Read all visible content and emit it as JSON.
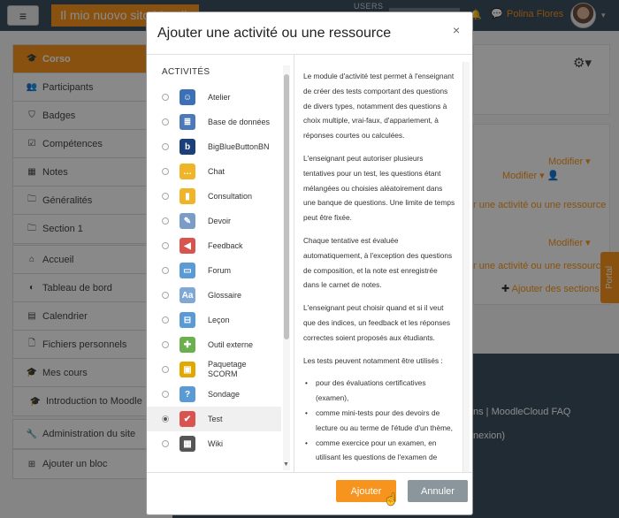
{
  "navbar": {
    "site_name": "Il mio nuovo sito Moodle",
    "users_label": "USERS",
    "user_name": "Polina Flores"
  },
  "sidebar": {
    "group1": [
      {
        "label": "Corso",
        "icon": "graduation-cap-icon",
        "glyph": "🎓",
        "active": true
      },
      {
        "label": "Participants",
        "icon": "users-icon",
        "glyph": "👥"
      },
      {
        "label": "Badges",
        "icon": "shield-icon",
        "glyph": "⛉"
      },
      {
        "label": "Compétences",
        "icon": "checkbox-icon",
        "glyph": "☑"
      },
      {
        "label": "Notes",
        "icon": "table-icon",
        "glyph": "▦"
      },
      {
        "label": "Généralités",
        "icon": "folder-icon",
        "glyph": "🗀"
      },
      {
        "label": "Section 1",
        "icon": "folder-icon",
        "glyph": "🗀"
      }
    ],
    "group2": [
      {
        "label": "Accueil",
        "icon": "home-icon",
        "glyph": "⌂"
      },
      {
        "label": "Tableau de bord",
        "icon": "dashboard-icon",
        "glyph": "◐"
      },
      {
        "label": "Calendrier",
        "icon": "calendar-icon",
        "glyph": "▤"
      },
      {
        "label": "Fichiers personnels",
        "icon": "file-icon",
        "glyph": "🗋"
      },
      {
        "label": "Mes cours",
        "icon": "graduation-cap-icon",
        "glyph": "🎓"
      },
      {
        "label": "Introduction to Moodle",
        "icon": "graduation-cap-icon",
        "glyph": "🎓",
        "indent": true
      }
    ],
    "admin": {
      "label": "Administration du site",
      "icon": "wrench-icon",
      "glyph": "🔧"
    },
    "add_block": {
      "label": "Ajouter un bloc",
      "icon": "plus-square-icon",
      "glyph": "⊞"
    }
  },
  "background": {
    "modifier": "Modifier",
    "add_activity": "r une activité ou une ressource",
    "add_sections": "Ajouter des sections",
    "footer_links": "ns | MoodleCloud FAQ",
    "footer_sub": "nexion)",
    "portal": "Portal"
  },
  "modal": {
    "title": "Ajouter une activité ou une ressource",
    "close": "×",
    "list_header": "ACTIVITÉS",
    "activities": [
      {
        "label": "Atelier",
        "icon": "workshop-icon",
        "color": "#3b6fb6",
        "glyph": "☺"
      },
      {
        "label": "Base de données",
        "icon": "database-icon",
        "color": "#4a78b8",
        "glyph": "≣"
      },
      {
        "label": "BigBlueButtonBN",
        "icon": "bigbluebutton-icon",
        "color": "#1a3f7a",
        "glyph": "b"
      },
      {
        "label": "Chat",
        "icon": "chat-icon",
        "color": "#f0b429",
        "glyph": "…"
      },
      {
        "label": "Consultation",
        "icon": "choice-icon",
        "color": "#f0b429",
        "glyph": "▮"
      },
      {
        "label": "Devoir",
        "icon": "assignment-icon",
        "color": "#7c9cc8",
        "glyph": "✎"
      },
      {
        "label": "Feedback",
        "icon": "feedback-icon",
        "color": "#d9534f",
        "glyph": "◀"
      },
      {
        "label": "Forum",
        "icon": "forum-icon",
        "color": "#5b9bd5",
        "glyph": "▭"
      },
      {
        "label": "Glossaire",
        "icon": "glossary-icon",
        "color": "#7fa8d6",
        "glyph": "Aa"
      },
      {
        "label": "Leçon",
        "icon": "lesson-icon",
        "color": "#5b9bd5",
        "glyph": "⊟"
      },
      {
        "label": "Outil externe",
        "icon": "lti-icon",
        "color": "#6ab04c",
        "glyph": "✚"
      },
      {
        "label": "Paquetage SCORM",
        "icon": "scorm-icon",
        "color": "#e0a800",
        "glyph": "▣"
      },
      {
        "label": "Sondage",
        "icon": "survey-icon",
        "color": "#5b9bd5",
        "glyph": "?"
      },
      {
        "label": "Test",
        "icon": "quiz-icon",
        "color": "#d9534f",
        "glyph": "✔",
        "selected": true
      },
      {
        "label": "Wiki",
        "icon": "wiki-icon",
        "color": "#555555",
        "glyph": "▦"
      }
    ],
    "description": {
      "p1": "Le module d'activité test permet à l'enseignant de créer des tests comportant des questions de divers types, notamment des questions à choix multiple, vrai-faux, d'appariement, à réponses courtes ou calculées.",
      "p2": "L'enseignant peut autoriser plusieurs tentatives pour un test, les questions étant mélangées ou choisies aléatoirement dans une banque de questions. Une limite de temps peut être fixée.",
      "p3": "Chaque tentative est évaluée automatiquement, à l'exception des questions de composition, et la note est enregistrée dans le carnet de notes.",
      "p4": "L'enseignant peut choisir quand et si il veut que des indices, un feedback et les réponses correctes soient proposés aux étudiants.",
      "p5": "Les tests peuvent notamment être utilisés :",
      "bullets": [
        "pour des évaluations certificatives (examen),",
        "comme mini-tests pour des devoirs de lecture ou au terme de l'étude d'un thème,",
        "comme exercice pour un examen, en utilisant les questions de l'examen de"
      ]
    },
    "add_button": "Ajouter",
    "cancel_button": "Annuler"
  },
  "colors": {
    "accent": "#f7941d",
    "navbar": "#3d4f5d"
  }
}
